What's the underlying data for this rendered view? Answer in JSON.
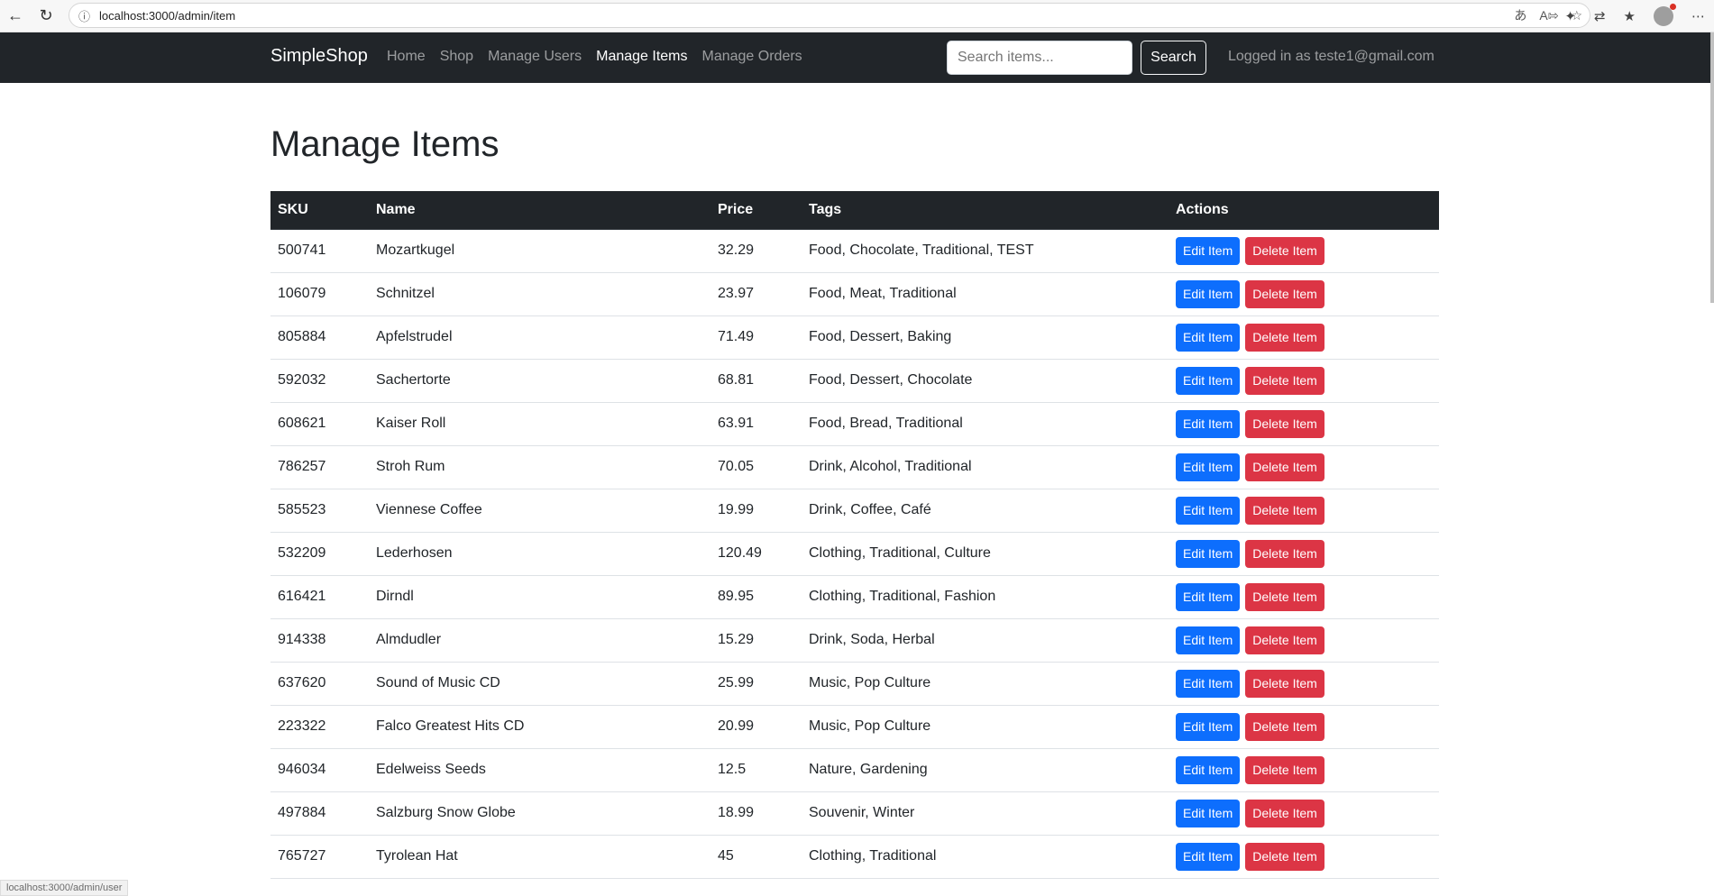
{
  "browser": {
    "url": "localhost:3000/admin/item",
    "status_url": "localhost:3000/admin/user"
  },
  "navbar": {
    "brand": "SimpleShop",
    "links": [
      "Home",
      "Shop",
      "Manage Users",
      "Manage Items",
      "Manage Orders"
    ],
    "active_link": "Manage Items",
    "search_placeholder": "Search items...",
    "search_button": "Search",
    "logged_in_text": "Logged in as teste1@gmail.com"
  },
  "page": {
    "title": "Manage Items"
  },
  "table": {
    "headers": [
      "SKU",
      "Name",
      "Price",
      "Tags",
      "Actions"
    ],
    "edit_label": "Edit Item",
    "delete_label": "Delete Item",
    "rows": [
      {
        "sku": "500741",
        "name": "Mozartkugel",
        "price": "32.29",
        "tags": "Food, Chocolate, Traditional, TEST"
      },
      {
        "sku": "106079",
        "name": "Schnitzel",
        "price": "23.97",
        "tags": "Food, Meat, Traditional"
      },
      {
        "sku": "805884",
        "name": "Apfelstrudel",
        "price": "71.49",
        "tags": "Food, Dessert, Baking"
      },
      {
        "sku": "592032",
        "name": "Sachertorte",
        "price": "68.81",
        "tags": "Food, Dessert, Chocolate"
      },
      {
        "sku": "608621",
        "name": "Kaiser Roll",
        "price": "63.91",
        "tags": "Food, Bread, Traditional"
      },
      {
        "sku": "786257",
        "name": "Stroh Rum",
        "price": "70.05",
        "tags": "Drink, Alcohol, Traditional"
      },
      {
        "sku": "585523",
        "name": "Viennese Coffee",
        "price": "19.99",
        "tags": "Drink, Coffee, Café"
      },
      {
        "sku": "532209",
        "name": "Lederhosen",
        "price": "120.49",
        "tags": "Clothing, Traditional, Culture"
      },
      {
        "sku": "616421",
        "name": "Dirndl",
        "price": "89.95",
        "tags": "Clothing, Traditional, Fashion"
      },
      {
        "sku": "914338",
        "name": "Almdudler",
        "price": "15.29",
        "tags": "Drink, Soda, Herbal"
      },
      {
        "sku": "637620",
        "name": "Sound of Music CD",
        "price": "25.99",
        "tags": "Music, Pop Culture"
      },
      {
        "sku": "223322",
        "name": "Falco Greatest Hits CD",
        "price": "20.99",
        "tags": "Music, Pop Culture"
      },
      {
        "sku": "946034",
        "name": "Edelweiss Seeds",
        "price": "12.5",
        "tags": "Nature, Gardening"
      },
      {
        "sku": "497884",
        "name": "Salzburg Snow Globe",
        "price": "18.99",
        "tags": "Souvenir, Winter"
      },
      {
        "sku": "765727",
        "name": "Tyrolean Hat",
        "price": "45",
        "tags": "Clothing, Traditional"
      }
    ]
  },
  "colors": {
    "navbar_bg": "#212529",
    "edit_button": "#0d6efd",
    "delete_button": "#dc3545"
  }
}
